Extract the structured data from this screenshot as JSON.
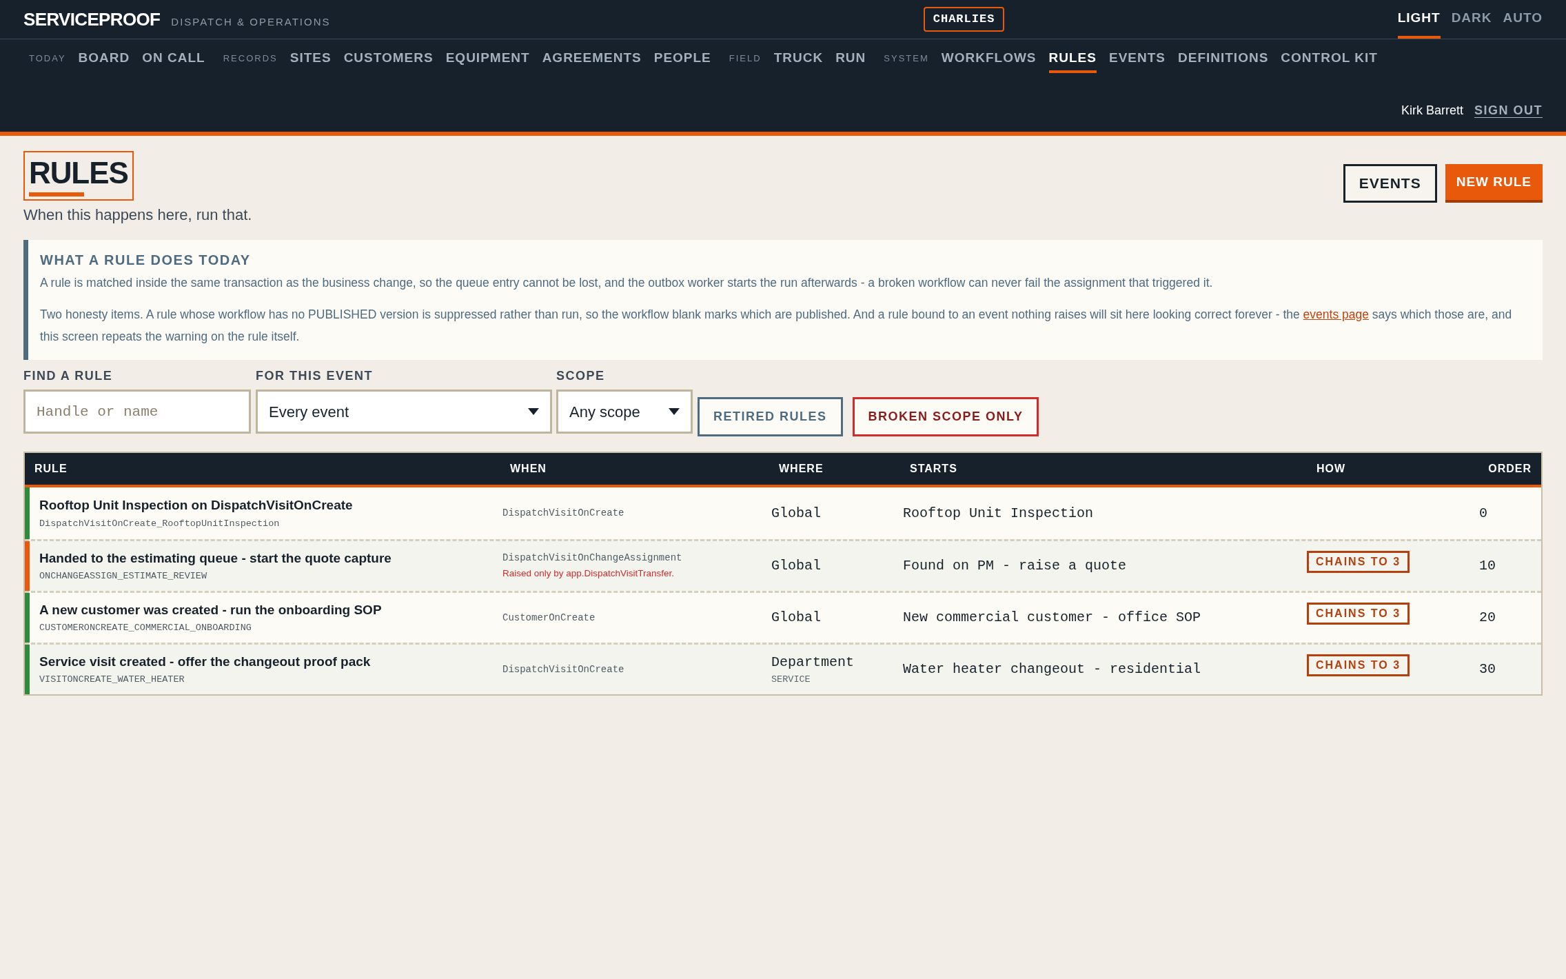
{
  "brand": {
    "name": "SERVICEPROOF",
    "tagline": "DISPATCH & OPERATIONS"
  },
  "tenant": "CHARLIES",
  "theme_options": [
    {
      "label": "LIGHT",
      "selected": true
    },
    {
      "label": "DARK",
      "selected": false
    },
    {
      "label": "AUTO",
      "selected": false
    }
  ],
  "nav": [
    {
      "kind": "section",
      "label": "TODAY"
    },
    {
      "kind": "link",
      "label": "BOARD",
      "selected": false
    },
    {
      "kind": "link",
      "label": "ON CALL",
      "selected": false
    },
    {
      "kind": "section",
      "label": "RECORDS"
    },
    {
      "kind": "link",
      "label": "SITES",
      "selected": false
    },
    {
      "kind": "link",
      "label": "CUSTOMERS",
      "selected": false
    },
    {
      "kind": "link",
      "label": "EQUIPMENT",
      "selected": false
    },
    {
      "kind": "link",
      "label": "AGREEMENTS",
      "selected": false
    },
    {
      "kind": "link",
      "label": "PEOPLE",
      "selected": false
    },
    {
      "kind": "section",
      "label": "FIELD"
    },
    {
      "kind": "link",
      "label": "TRUCK",
      "selected": false
    },
    {
      "kind": "link",
      "label": "RUN",
      "selected": false
    },
    {
      "kind": "section",
      "label": "SYSTEM"
    },
    {
      "kind": "link",
      "label": "WORKFLOWS",
      "selected": false
    },
    {
      "kind": "link",
      "label": "RULES",
      "selected": true
    },
    {
      "kind": "link",
      "label": "EVENTS",
      "selected": false
    },
    {
      "kind": "link",
      "label": "DEFINITIONS",
      "selected": false
    },
    {
      "kind": "link",
      "label": "CONTROL KIT",
      "selected": false
    }
  ],
  "user": {
    "name": "Kirk Barrett",
    "sign_out": "SIGN OUT"
  },
  "page": {
    "title": "RULES",
    "subtitle": "When this happens here, run that.",
    "buttons": [
      {
        "kind": "secondary",
        "label": "EVENTS"
      },
      {
        "kind": "primary",
        "label": "NEW RULE"
      }
    ]
  },
  "notice": {
    "heading": "WHAT A RULE DOES TODAY",
    "paragraphs": [
      {
        "text": "A rule is matched inside the same transaction as the business change, so the queue entry cannot be lost, and the outbox worker starts the run afterwards - a broken workflow can never fail the assignment that triggered it."
      },
      {
        "text": "Two honesty items. A rule whose workflow has no PUBLISHED version is suppressed rather than run, so the workflow blank marks which are published. And a rule bound to an event nothing raises will sit here looking correct forever - the",
        "link": "events page",
        "after": "says which those are, and this screen repeats the warning on the rule itself."
      }
    ]
  },
  "filters": {
    "find": {
      "label": "FIND A RULE",
      "placeholder": "Handle or name"
    },
    "event": {
      "label": "FOR THIS EVENT",
      "value": "Every event"
    },
    "scope": {
      "label": "SCOPE",
      "value": "Any scope"
    },
    "toggles": [
      {
        "kind": "neutral",
        "label": "RETIRED RULES"
      },
      {
        "kind": "danger",
        "label": "BROKEN SCOPE ONLY"
      }
    ]
  },
  "table": {
    "columns": [
      "RULE",
      "WHEN",
      "WHERE",
      "STARTS",
      "HOW",
      "ORDER"
    ],
    "rows": [
      {
        "color": "#2e8b3e",
        "name": "Rooftop Unit Inspection on DispatchVisitOnCreate",
        "handle": "DispatchVisitOnCreate_RooftopUnitInspection",
        "when": "DispatchVisitOnCreate",
        "where": "Global",
        "starts": "Rooftop Unit Inspection",
        "order": "0"
      },
      {
        "color": "#e8590c",
        "name": "Handed to the estimating queue - start the quote capture",
        "handle": "ONCHANGEASSIGN_ESTIMATE_REVIEW",
        "when": "DispatchVisitOnChangeAssignment",
        "warning": "Raised only by app.DispatchVisitTransfer.",
        "where": "Global",
        "starts": "Found on PM - raise a quote",
        "how": "CHAINS TO 3",
        "order": "10"
      },
      {
        "color": "#2e8b3e",
        "name": "A new customer was created - run the onboarding SOP",
        "handle": "CUSTOMERONCREATE_COMMERCIAL_ONBOARDING",
        "when": "CustomerOnCreate",
        "where": "Global",
        "starts": "New commercial customer - office SOP",
        "how": "CHAINS TO 3",
        "order": "20"
      },
      {
        "color": "#2e8b3e",
        "name": "Service visit created - offer the changeout proof pack",
        "handle": "VISITONCREATE_WATER_HEATER",
        "when": "DispatchVisitOnCreate",
        "where": "Department",
        "where_detail": "SERVICE",
        "starts": "Water heater changeout - residential",
        "how": "CHAINS TO 3",
        "order": "30"
      }
    ]
  }
}
